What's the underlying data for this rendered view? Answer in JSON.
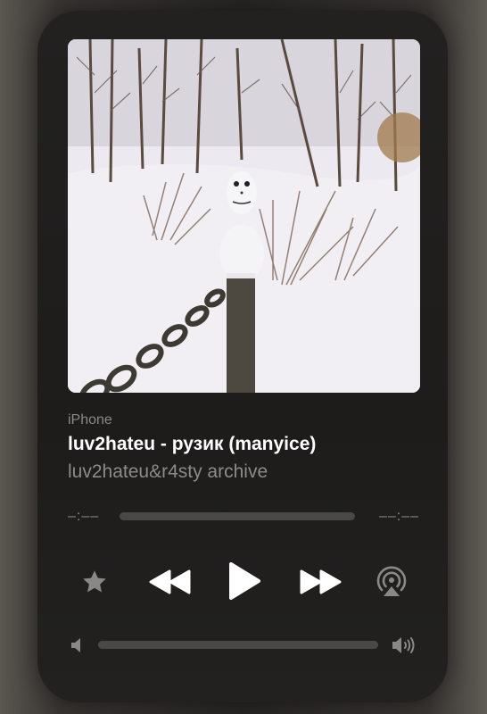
{
  "player": {
    "device": "iPhone",
    "track_title": "luv2hateu - рузик (manyice)",
    "artist": "luv2hateu&r4sty archive",
    "elapsed": "–:––",
    "remaining": "––:––",
    "progress_fraction": 0,
    "volume_fraction": 1.0
  },
  "artwork": {
    "description_icon": "album-artwork"
  },
  "controls": {
    "favorite": "star-icon",
    "previous": "rewind-icon",
    "play": "play-icon",
    "next": "fast-forward-icon",
    "output": "airplay-icon",
    "volume_low": "speaker-low-icon",
    "volume_high": "speaker-high-icon"
  },
  "colors": {
    "card_bg": "#1f1e1d",
    "primary_text": "#ffffff",
    "secondary_text": "#8d8b88",
    "track": "#4a4846",
    "icon": "#ffffff",
    "icon_dim": "#8a8886"
  }
}
